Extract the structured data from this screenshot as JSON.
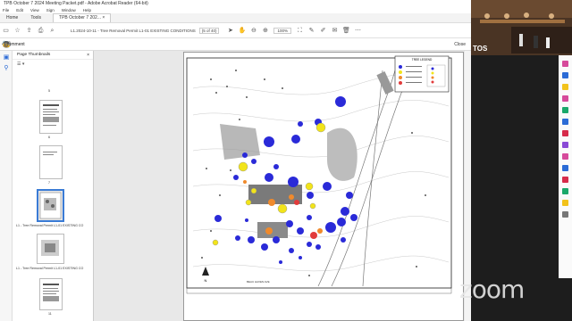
{
  "window": {
    "title": "TPB October 7 2024 Meeting Packet.pdf - Adobe Acrobat Reader (64-bit)",
    "menu": [
      "File",
      "Edit",
      "View",
      "Sign",
      "Window",
      "Help"
    ]
  },
  "tabs": {
    "home": "Home",
    "tools": "Tools",
    "doc": "TPB October 7 202...",
    "doc_close": "×"
  },
  "toolbar": {
    "doc_name": "L1.2024-10-11 - Tree Removal Permit L1-01 EXISTING CONDITIONS",
    "page": "(5 of 40)",
    "zoom": "100%"
  },
  "comment_bar": {
    "label": "Comment",
    "close": "Close"
  },
  "thumbnails": {
    "header": "Page Thumbnails",
    "close": "×",
    "captions": [
      "5",
      "6",
      "7",
      "L1 - Tree Removal Permit L1-01 EXISTING CO",
      "L1 - Tree Removal Permit L1-01 EXISTING CO",
      "11"
    ]
  },
  "plan": {
    "legend_title": "TREE LEGEND",
    "north_label": "N",
    "street_label": "BEAU HAVEN AVE"
  },
  "zoom": {
    "camera_label": "TOS",
    "watermark": "zoom"
  },
  "colors": {
    "accent": "#2b6bd6",
    "selected_thumb": "#3a7bd5",
    "tree_blue": "#2a2ad8",
    "tree_yellow": "#f2e41a",
    "tree_orange": "#f08a2c",
    "tree_red": "#e23b3b"
  }
}
